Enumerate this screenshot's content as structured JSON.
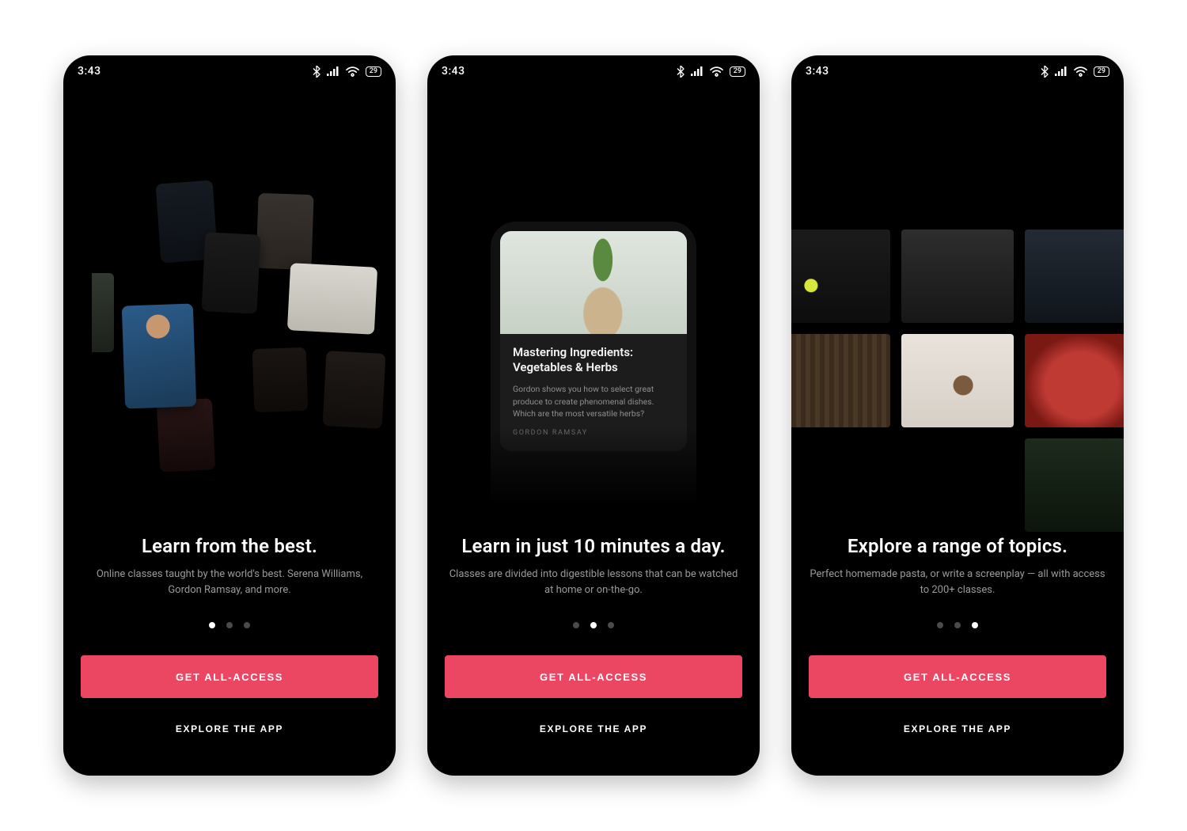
{
  "statusbar": {
    "time": "3:43",
    "battery": "29"
  },
  "screens": [
    {
      "headline": "Learn from the best.",
      "sub": "Online classes taught by the world's best. Serena Williams, Gordon Ramsay, and more.",
      "activeDot": 0
    },
    {
      "headline": "Learn in just 10 minutes a day.",
      "sub": "Classes are divided into digestible lessons that can be watched at home or on-the-go.",
      "activeDot": 1,
      "lesson": {
        "title": "Mastering Ingredients: Vegetables & Herbs",
        "desc": "Gordon shows you how to select great produce to create phenomenal dishes. Which are the most versatile herbs?",
        "author": "GORDON RAMSAY"
      }
    },
    {
      "headline": "Explore a range of topics.",
      "sub": "Perfect homemade pasta, or write a screenplay — all with access to 200+ classes.",
      "activeDot": 2
    }
  ],
  "cta": {
    "primary": "GET ALL-ACCESS",
    "secondary": "EXPLORE THE APP"
  },
  "colors": {
    "accent": "#eb4763"
  }
}
